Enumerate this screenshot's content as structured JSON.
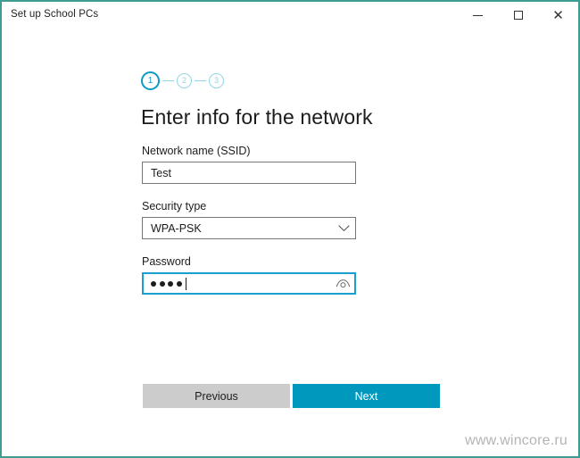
{
  "window": {
    "title": "Set up School PCs",
    "border_color": "#3e9c93",
    "caption": {
      "minimize": "minimize-icon",
      "maximize": "maximize-icon",
      "close": "close-icon"
    }
  },
  "wizard": {
    "steps": [
      {
        "number": "1",
        "state": "active"
      },
      {
        "number": "2",
        "state": "inactive"
      },
      {
        "number": "3",
        "state": "inactive"
      }
    ],
    "active_color": "#0b9bc4",
    "inactive_color": "#93d4e8",
    "heading": "Enter info for the network"
  },
  "form": {
    "ssid": {
      "label": "Network name (SSID)",
      "value": "Test",
      "placeholder": ""
    },
    "security": {
      "label": "Security type",
      "value": "WPA-PSK",
      "chevron": "chevron-down-icon",
      "options": [
        "WPA-PSK"
      ]
    },
    "password": {
      "label": "Password",
      "value": "••••",
      "dot_count": 4,
      "focused": true,
      "reveal_icon": "eye-icon",
      "focus_color": "#1c9ed1"
    }
  },
  "footer": {
    "previous_label": "Previous",
    "previous_color": "#cccccc",
    "next_label": "Next",
    "next_color": "#0098bd"
  },
  "watermark": "www.wincore.ru"
}
